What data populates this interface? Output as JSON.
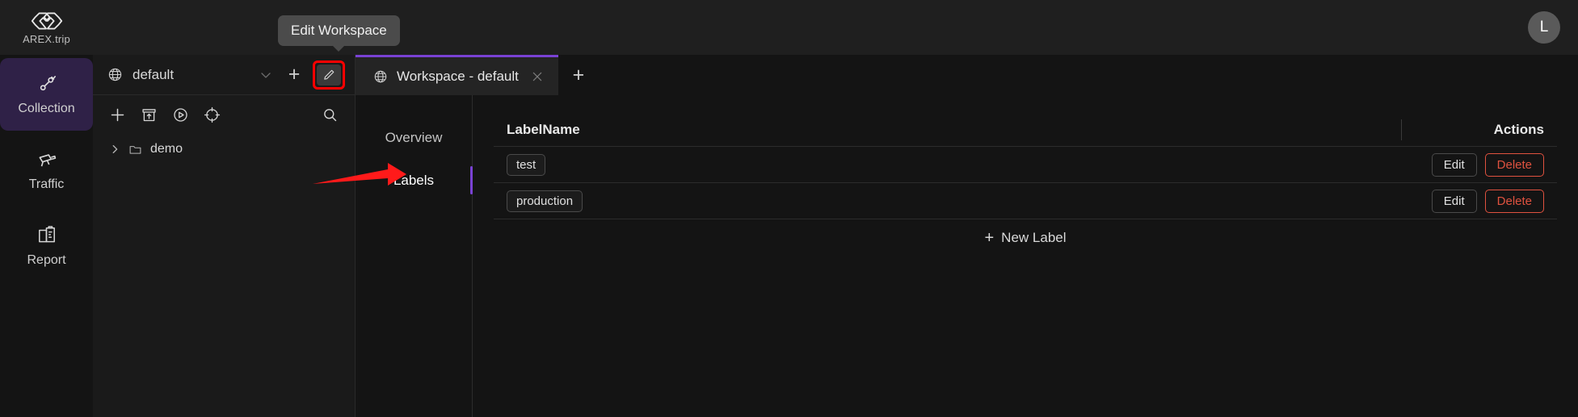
{
  "brand": {
    "name": "AREX.trip",
    "logo_icon": "arex-hexagon-logo-icon"
  },
  "tooltip": {
    "text": "Edit Workspace"
  },
  "user": {
    "avatar_initial": "L"
  },
  "colors": {
    "accent_purple": "#7a42d4",
    "rail_active_bg": "#2f2147",
    "danger_red": "#e0523f",
    "annotation_red": "#ff0000",
    "page_bg": "#141414",
    "panel_bg": "#1a1a1a",
    "topbar_bg": "#1f1f1f"
  },
  "rail": {
    "items": [
      {
        "label": "Collection",
        "icon": "collection-link-icon",
        "active": true
      },
      {
        "label": "Traffic",
        "icon": "traffic-camera-icon",
        "active": false
      },
      {
        "label": "Report",
        "icon": "report-clipboard-icon",
        "active": false
      }
    ]
  },
  "collection_panel": {
    "workspace_selector": {
      "icon": "globe-icon",
      "name": "default",
      "chevron_icon": "chevron-down-icon",
      "add_label": "+",
      "edit_icon": "pencil-edit-icon"
    },
    "toolbar": {
      "add_icon": "plus-icon",
      "import_icon": "import-box-icon",
      "run_icon": "play-circle-icon",
      "target_icon": "target-crosshair-icon",
      "search_icon": "search-icon"
    },
    "tree": [
      {
        "label": "demo",
        "caret_icon": "chevron-right-icon",
        "folder_icon": "folder-icon",
        "expanded": false
      }
    ]
  },
  "tabs": {
    "items": [
      {
        "label": "Workspace - default",
        "icon": "globe-icon",
        "close_icon": "close-icon",
        "active": true
      }
    ],
    "add_tab_label": "+"
  },
  "subnav": {
    "items": [
      {
        "label": "Overview",
        "active": false
      },
      {
        "label": "Labels",
        "active": true
      }
    ]
  },
  "labels_table": {
    "columns": [
      "LabelName",
      "Actions"
    ],
    "rows": [
      {
        "name": "test",
        "edit_label": "Edit",
        "delete_label": "Delete"
      },
      {
        "name": "production",
        "edit_label": "Edit",
        "delete_label": "Delete"
      }
    ],
    "new_label": {
      "plus": "+",
      "text": "New Label"
    }
  },
  "annotations": {
    "arrow_target": "Labels",
    "highlight_target": "Edit Workspace button"
  }
}
